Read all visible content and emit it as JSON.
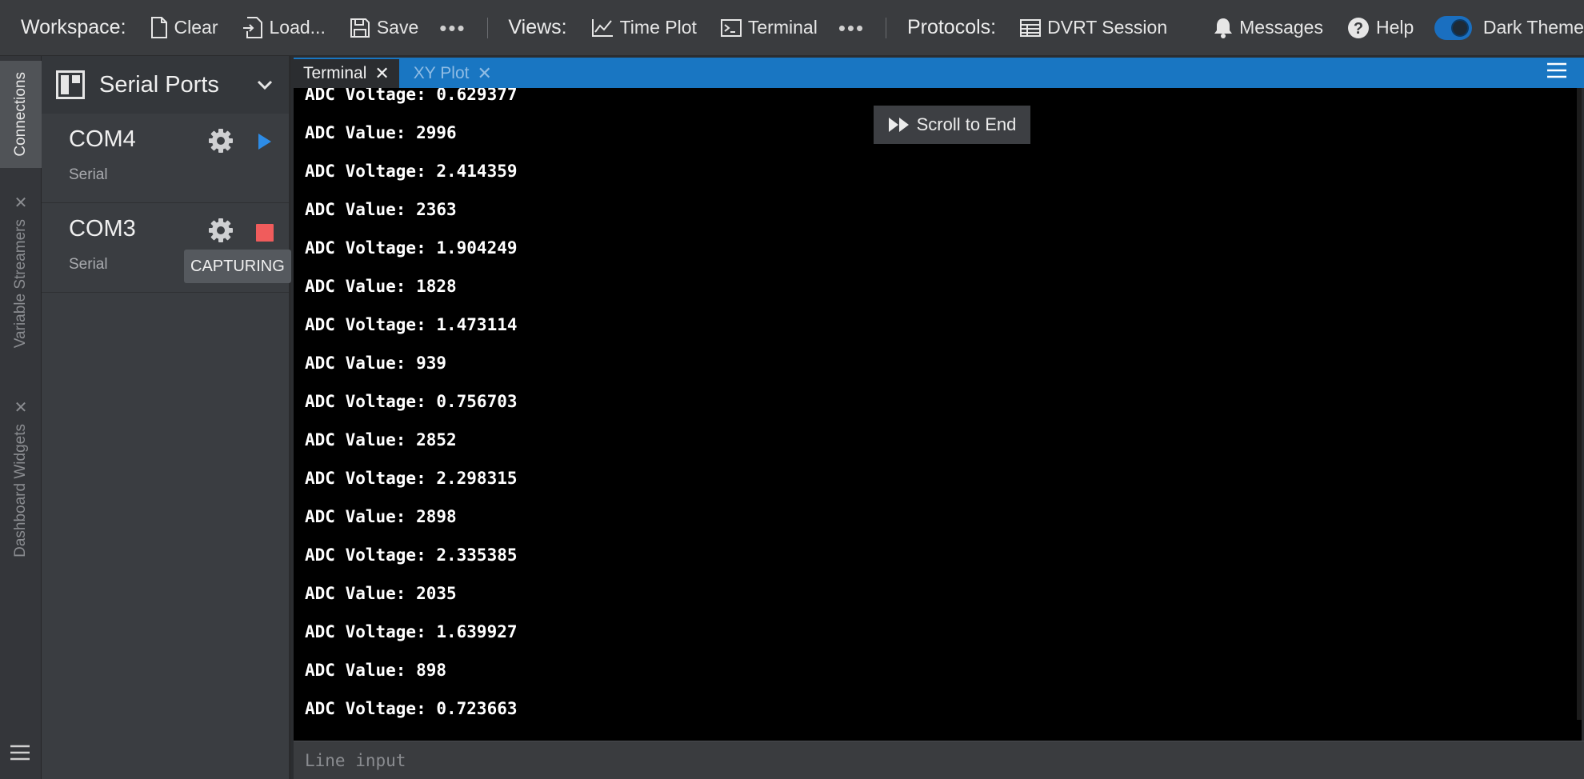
{
  "toolbar": {
    "workspace_label": "Workspace:",
    "clear": "Clear",
    "load": "Load...",
    "save": "Save",
    "more": "•••",
    "views_label": "Views:",
    "time_plot": "Time Plot",
    "terminal": "Terminal",
    "protocols_label": "Protocols:",
    "dvrt_session": "DVRT Session",
    "messages": "Messages",
    "help": "Help",
    "dark_theme": "Dark Theme",
    "dark_theme_on": true
  },
  "rail": {
    "connections": "Connections",
    "variable_streamers": "Variable Streamers",
    "dashboard_widgets": "Dashboard Widgets"
  },
  "sidebar": {
    "title": "Serial Ports",
    "ports": [
      {
        "name": "COM4",
        "type": "Serial",
        "state": "stopped"
      },
      {
        "name": "COM3",
        "type": "Serial",
        "state": "capturing",
        "badge": "CAPTURING"
      }
    ]
  },
  "tabs": [
    {
      "label": "Terminal",
      "active": true
    },
    {
      "label": "XY Plot",
      "active": false
    }
  ],
  "terminal": {
    "scroll_to_end": "Scroll to End",
    "lines": [
      "ADC Voltage: 0.629377",
      "ADC Value: 2996",
      "ADC Voltage: 2.414359",
      "ADC Value: 2363",
      "ADC Voltage: 1.904249",
      "ADC Value: 1828",
      "ADC Voltage: 1.473114",
      "ADC Value: 939",
      "ADC Voltage: 0.756703",
      "ADC Value: 2852",
      "ADC Voltage: 2.298315",
      "ADC Value: 2898",
      "ADC Voltage: 2.335385",
      "ADC Value: 2035",
      "ADC Voltage: 1.639927",
      "ADC Value: 898",
      "ADC Voltage: 0.723663"
    ]
  },
  "line_input": {
    "placeholder": "Line input",
    "value": ""
  },
  "colors": {
    "accent": "#1976c2",
    "stop_red": "#f05c5c",
    "play_blue": "#2d8ce6"
  }
}
